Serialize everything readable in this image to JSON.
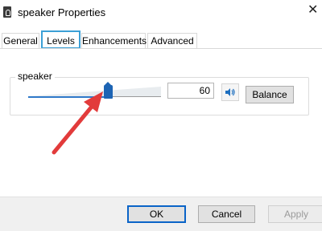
{
  "window": {
    "title": "speaker Properties"
  },
  "tabs": [
    {
      "label": "General",
      "active": false
    },
    {
      "label": "Levels",
      "active": true
    },
    {
      "label": "Enhancements",
      "active": false
    },
    {
      "label": "Advanced",
      "active": false
    }
  ],
  "levels": {
    "device_label": "speaker",
    "volume_value": "60",
    "volume_fraction": 0.6,
    "balance_label": "Balance"
  },
  "buttons": {
    "ok": "OK",
    "cancel": "Cancel",
    "apply": "Apply"
  },
  "colors": {
    "accent": "#0a64c8",
    "tab_highlight": "#3ca0d6",
    "arrow": "#e23b3b",
    "thumb": "#1d64b4"
  }
}
